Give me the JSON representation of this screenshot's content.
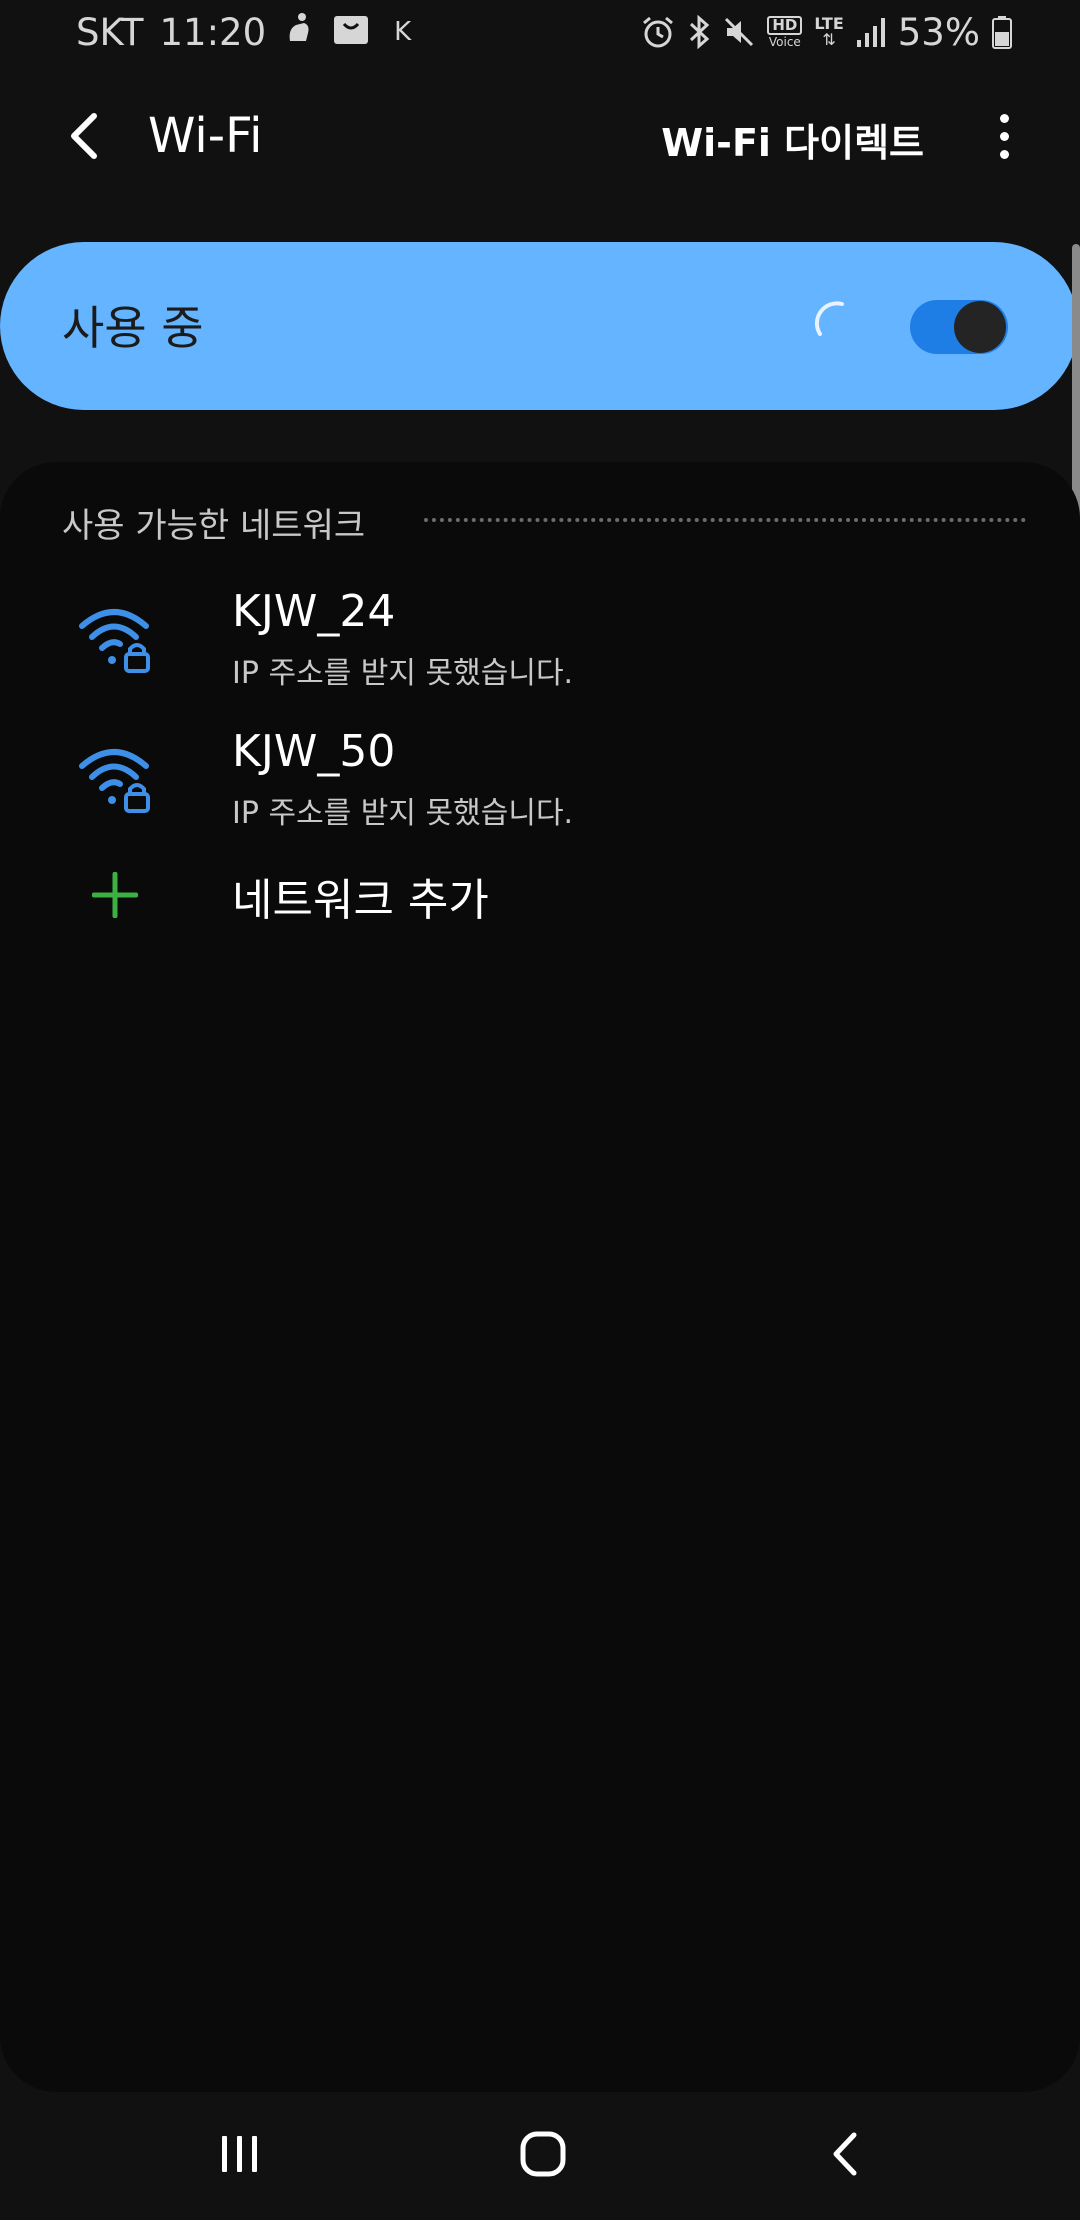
{
  "status_bar": {
    "carrier": "SKT",
    "time": "11:20",
    "k_indicator": "K",
    "hd_label": "HD",
    "voice_label": "Voice",
    "lte_label": "LTE",
    "lte_arrows": "⇅",
    "battery": "53%",
    "icons": [
      "gesture-icon",
      "shopping-bag-icon",
      "alarm-icon",
      "bluetooth-icon",
      "mute-icon",
      "hd-voice-icon",
      "lte-icon",
      "signal-icon",
      "battery-icon"
    ]
  },
  "app_bar": {
    "title": "Wi-Fi",
    "wifi_direct_label": "Wi-Fi 다이렉트"
  },
  "master_switch": {
    "label": "사용 중",
    "enabled": true,
    "accent": "#64b4ff",
    "track_color": "#1f7de6"
  },
  "networks": {
    "section_title": "사용 가능한 네트워크",
    "items": [
      {
        "ssid": "KJW_24",
        "status": "IP 주소를 받지 못했습니다.",
        "secured": true
      },
      {
        "ssid": "KJW_50",
        "status": "IP 주소를 받지 못했습니다.",
        "secured": true
      }
    ],
    "add_label": "네트워크 추가",
    "icon_color": "#3d8fe8",
    "add_color": "#3cb043"
  },
  "nav_bar": {
    "buttons": [
      "recents-icon",
      "home-icon",
      "back-icon"
    ]
  }
}
